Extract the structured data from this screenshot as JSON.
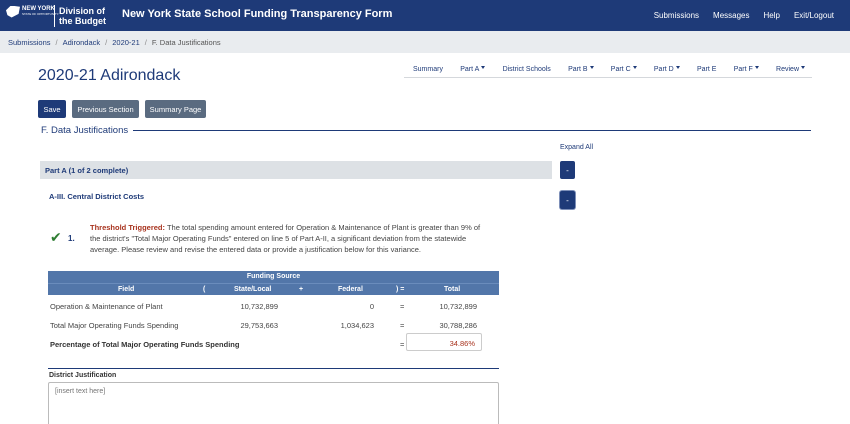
{
  "header": {
    "logo_state_text": "NEW YORK",
    "logo_state_subtext": "STATE OF OPPORTUNITY.",
    "logo_line1": "Division of",
    "logo_line2": "the Budget",
    "app_title": "New York State School Funding Transparency Form",
    "nav": [
      "Submissions",
      "Messages",
      "Help",
      "Exit/Logout"
    ]
  },
  "breadcrumb": {
    "items": [
      "Submissions",
      "Adirondack",
      "2020-21"
    ],
    "current": "F. Data Justifications",
    "separator": "/"
  },
  "page": {
    "title": "2020-21 Adirondack"
  },
  "tabs": [
    {
      "label": "Summary",
      "dropdown": false
    },
    {
      "label": "Part A",
      "dropdown": true
    },
    {
      "label": "District Schools",
      "dropdown": false
    },
    {
      "label": "Part B",
      "dropdown": true
    },
    {
      "label": "Part C",
      "dropdown": true
    },
    {
      "label": "Part D",
      "dropdown": true
    },
    {
      "label": "Part E",
      "dropdown": false
    },
    {
      "label": "Part F",
      "dropdown": true
    },
    {
      "label": "Review",
      "dropdown": true
    }
  ],
  "buttons": {
    "save": "Save",
    "previous": "Previous Section",
    "summary": "Summary Page"
  },
  "section": {
    "title": "F. Data Justifications",
    "expand_all": "Expand All",
    "part_label": "Part A (1 of 2 complete)",
    "part_toggle": "-",
    "sub_label": "A-III. Central District Costs",
    "sub_toggle": "-"
  },
  "item": {
    "number": "1.",
    "trigger_label": "Threshold Triggered:",
    "message": "The total spending amount entered for Operation & Maintenance of Plant is greater than 9% of the district's \"Total Major Operating Funds\" entered on line 5 of Part A-II, a significant deviation from the statewide average. Please review and revise the entered data or provide a justification below for this variance."
  },
  "table": {
    "group_header": "Funding Source",
    "columns": {
      "field": "Field",
      "open_paren": "(",
      "state_local": "State/Local",
      "plus": "+",
      "federal": "Federal",
      "close_eq": ") =",
      "total": "Total"
    },
    "rows": [
      {
        "field": "Operation & Maintenance of Plant",
        "state_local": "10,732,899",
        "federal": "0",
        "eq": "=",
        "total": "10,732,899"
      },
      {
        "field": "Total Major Operating Funds Spending",
        "state_local": "29,753,663",
        "federal": "1,034,623",
        "eq": "=",
        "total": "30,788,286"
      }
    ],
    "percentage_row": {
      "field": "Percentage of Total Major Operating Funds Spending",
      "eq": "=",
      "value": "34.86%"
    }
  },
  "justification": {
    "label": "District Justification",
    "placeholder": "[insert text here]"
  },
  "colors": {
    "brand": "#1e3a78",
    "table_header": "#5276a9",
    "warning": "#a8331e",
    "success": "#2e7d32"
  }
}
